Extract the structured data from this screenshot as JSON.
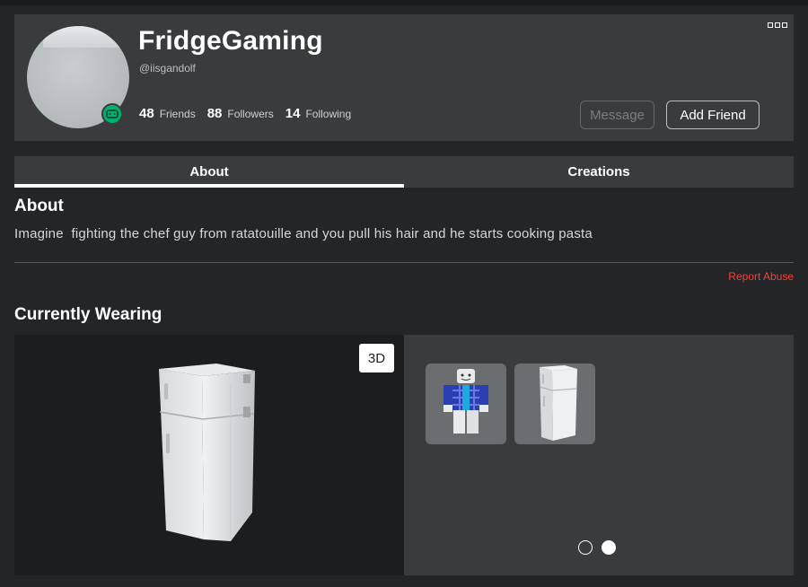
{
  "profile": {
    "display_name": "FridgeGaming",
    "username": "@iisgandolf",
    "stats": [
      {
        "count": "48",
        "label": "Friends"
      },
      {
        "count": "88",
        "label": "Followers"
      },
      {
        "count": "14",
        "label": "Following"
      }
    ],
    "message_label": "Message",
    "add_friend_label": "Add Friend",
    "presence_icon": "gamepad-icon",
    "presence_color": "#00b06f"
  },
  "tabs": [
    {
      "label": "About",
      "active": true
    },
    {
      "label": "Creations",
      "active": false
    }
  ],
  "about": {
    "title": "About",
    "text": "Imagine  fighting the chef guy from ratatouille and you pull his hair and he starts cooking pasta",
    "report_label": "Report Abuse"
  },
  "wearing": {
    "title": "Currently Wearing",
    "view_toggle_label": "3D",
    "items": [
      {
        "name": "avatar-outfit",
        "icon": "avatar-thumbnail"
      },
      {
        "name": "fridge-item",
        "icon": "fridge-thumbnail"
      }
    ],
    "pagination": {
      "pages": 2,
      "active": 2
    }
  },
  "colors": {
    "background": "#232527",
    "card": "#393b3d",
    "report": "#f4413d"
  }
}
